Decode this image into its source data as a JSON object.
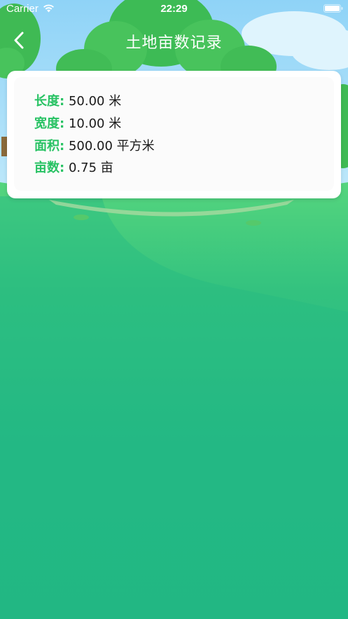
{
  "status_bar": {
    "carrier": "Carrier",
    "time": "22:29"
  },
  "nav": {
    "title": "土地亩数记录",
    "back_icon": "chevron-left-icon"
  },
  "record": {
    "length_label": "长度:",
    "length_value": "50.00 米",
    "width_label": "宽度:",
    "width_value": "10.00 米",
    "area_label": "面积:",
    "area_value": "500.00 平方米",
    "mu_label": "亩数:",
    "mu_value": "0.75 亩"
  },
  "colors": {
    "background": "#20b684",
    "label_green": "#27c263",
    "card": "#ffffff"
  }
}
